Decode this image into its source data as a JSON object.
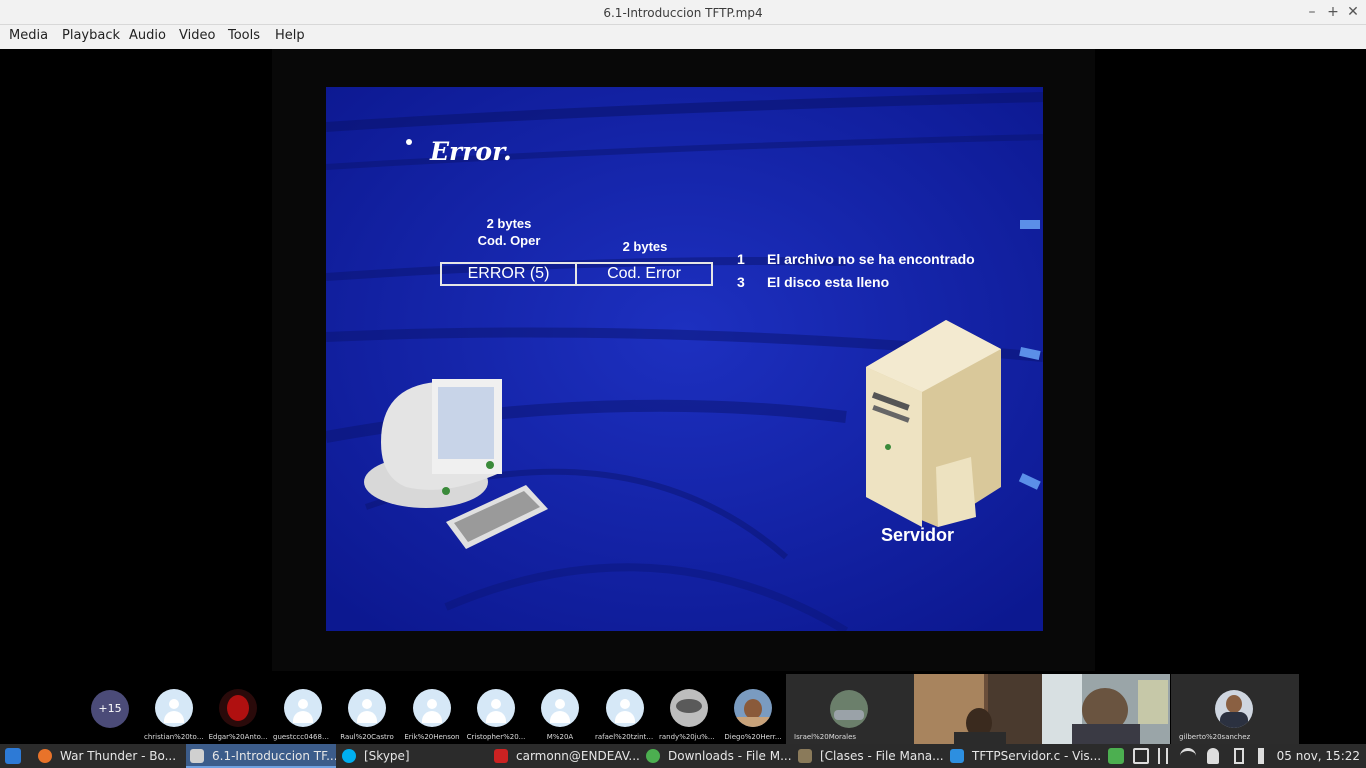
{
  "window": {
    "title": "6.1-Introduccion TFTP.mp4",
    "controls": [
      "–",
      "+",
      "✕"
    ]
  },
  "menu": [
    "Media",
    "Playback",
    "Audio",
    "Video",
    "Tools",
    "Help"
  ],
  "slide": {
    "title": "Error.",
    "field1_size": "2 bytes",
    "field1_name": "Cod. Oper",
    "field2_size": "2 bytes",
    "packet_cells": [
      "ERROR (5)",
      "Cod. Error"
    ],
    "codes": [
      {
        "num": "1",
        "text": "El archivo no se ha encontrado"
      },
      {
        "num": "3",
        "text": "El disco esta lleno"
      }
    ],
    "server_label": "Servidor"
  },
  "call": {
    "more_count": "+15",
    "participants": [
      "christian%20tor...",
      "Edgar%20Anto...",
      "guestccc04688...",
      "Raul%20Castro",
      "Erik%20Henson",
      "Cristopher%20...",
      "M%20A",
      "rafael%20tzintz...",
      "randy%20ju%C...",
      "Diego%20Herr..."
    ],
    "tiles": [
      "Israel%20Morales",
      "",
      "",
      "gilberto%20sanchez"
    ]
  },
  "taskbar": {
    "tasks": [
      {
        "label": "War Thunder - Bo...",
        "icon_color": "#e8732a",
        "icon": "firefox-icon"
      },
      {
        "label": "6.1-Introduccion TF...",
        "icon_color": "#cccccc",
        "icon": "media-player-icon",
        "active": true
      },
      {
        "label": "[Skype]",
        "icon_color": "#00aff0",
        "icon": "skype-icon"
      },
      {
        "label": "carmonn@ENDEAV...",
        "icon_color": "#cc2222",
        "icon": "terminal-icon"
      },
      {
        "label": "Downloads - File M...",
        "icon_color": "#4caf50",
        "icon": "download-icon"
      },
      {
        "label": "[Clases - File Mana...",
        "icon_color": "#8a7a5a",
        "icon": "folder-icon"
      },
      {
        "label": "TFTPServidor.c - Vis...",
        "icon_color": "#2d8fe0",
        "icon": "vscode-icon"
      }
    ],
    "clock": "05 nov, 15:22"
  }
}
